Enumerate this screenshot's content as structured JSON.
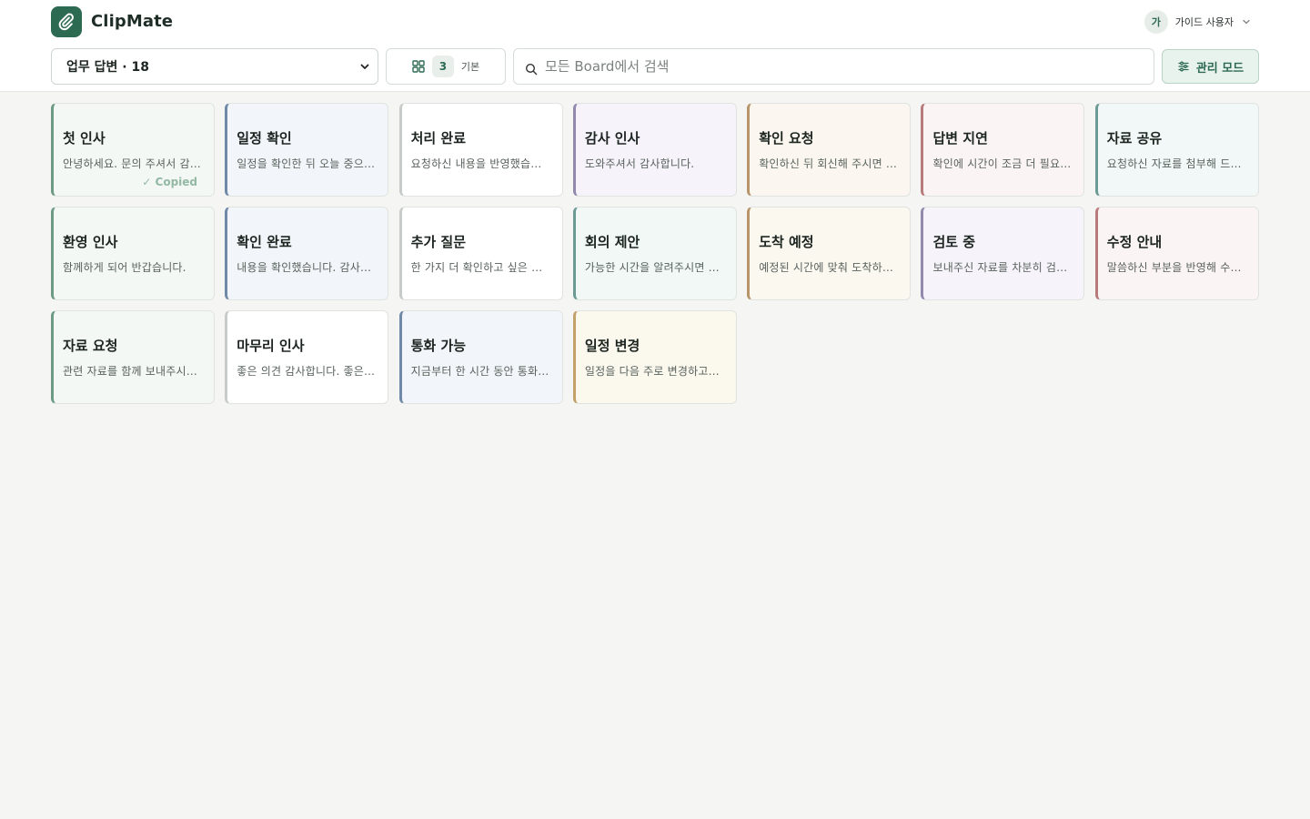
{
  "app": {
    "name": "ClipMate",
    "user_initial": "가",
    "user_name": "가이드 사용자"
  },
  "toolbar": {
    "board_selected": "업무 답변 · 18",
    "board_options": [
      "업무 답변 · 18"
    ],
    "view_count": "3",
    "view_label": "기본",
    "search_placeholder": "모든 Board에서 검색",
    "manage_label": "관리 모드"
  },
  "colors": {
    "brand": "#2d6a52"
  },
  "cards": [
    {
      "title": "첫 인사",
      "body": "안녕하세요. 문의 주셔서 감사합니다.",
      "bg": "#f3f8f4",
      "accent": "#6d9a84",
      "status": "✓ Copied"
    },
    {
      "title": "일정 확인",
      "body": "일정을 확인한 뒤 오늘 중으로 안내드리겠습니다.",
      "bg": "#f2f6fa",
      "accent": "#6f8aa8"
    },
    {
      "title": "처리 완료",
      "body": "요청하신 내용을 반영했습니다.",
      "bg": "#ffffff",
      "accent": "#c8ccc9"
    },
    {
      "title": "감사 인사",
      "body": "도와주셔서 감사합니다.",
      "bg": "#f6f4fa",
      "accent": "#9389ad"
    },
    {
      "title": "확인 요청",
      "body": "확인하신 뒤 회신해 주시면 감사하겠습니다.",
      "bg": "#fbf7f0",
      "accent": "#b8946a"
    },
    {
      "title": "답변 지연",
      "body": "확인에 시간이 조금 더 필요합니다.",
      "bg": "#fbf4f4",
      "accent": "#b87b7b"
    },
    {
      "title": "자료 공유",
      "body": "요청하신 자료를 첨부해 드립니다.",
      "bg": "#f2f8f7",
      "accent": "#6c9a94"
    },
    {
      "title": "환영 인사",
      "body": "함께하게 되어 반갑습니다.",
      "bg": "#f3f8f4",
      "accent": "#6d9a84"
    },
    {
      "title": "확인 완료",
      "body": "내용을 확인했습니다. 감사합니다.",
      "bg": "#f2f6fa",
      "accent": "#6f8aa8"
    },
    {
      "title": "추가 질문",
      "body": "한 가지 더 확인하고 싶은 점이 있습니다.",
      "bg": "#ffffff",
      "accent": "#c8ccc9"
    },
    {
      "title": "회의 제안",
      "body": "가능한 시간을 알려주시면 좋겠습니다.",
      "bg": "#f1f8f6",
      "accent": "#6c9a94"
    },
    {
      "title": "도착 예정",
      "body": "예정된 시간에 맞춰 도착하겠습니다.",
      "bg": "#fbf8f0",
      "accent": "#b8946a"
    },
    {
      "title": "검토 중",
      "body": "보내주신 자료를 차분히 검토하고 있습니다.",
      "bg": "#f6f4fa",
      "accent": "#9389ad"
    },
    {
      "title": "수정 안내",
      "body": "말씀하신 부분을 반영해 수정했습니다.",
      "bg": "#fbf4f4",
      "accent": "#b87b7b"
    },
    {
      "title": "자료 요청",
      "body": "관련 자료를 함께 보내주시면 감사하겠습니다.",
      "bg": "#f3f8f4",
      "accent": "#6d9a84"
    },
    {
      "title": "마무리 인사",
      "body": "좋은 의견 감사합니다. 좋은 하루 되세요.",
      "bg": "#ffffff",
      "accent": "#c8ccc9"
    },
    {
      "title": "통화 가능",
      "body": "지금부터 한 시간 동안 통화 가능합니다.",
      "bg": "#f2f6fa",
      "accent": "#6f8aa8"
    },
    {
      "title": "일정 변경",
      "body": "일정을 다음 주로 변경하고자 합니다.",
      "bg": "#fbf8ee",
      "accent": "#c4a06a"
    }
  ]
}
